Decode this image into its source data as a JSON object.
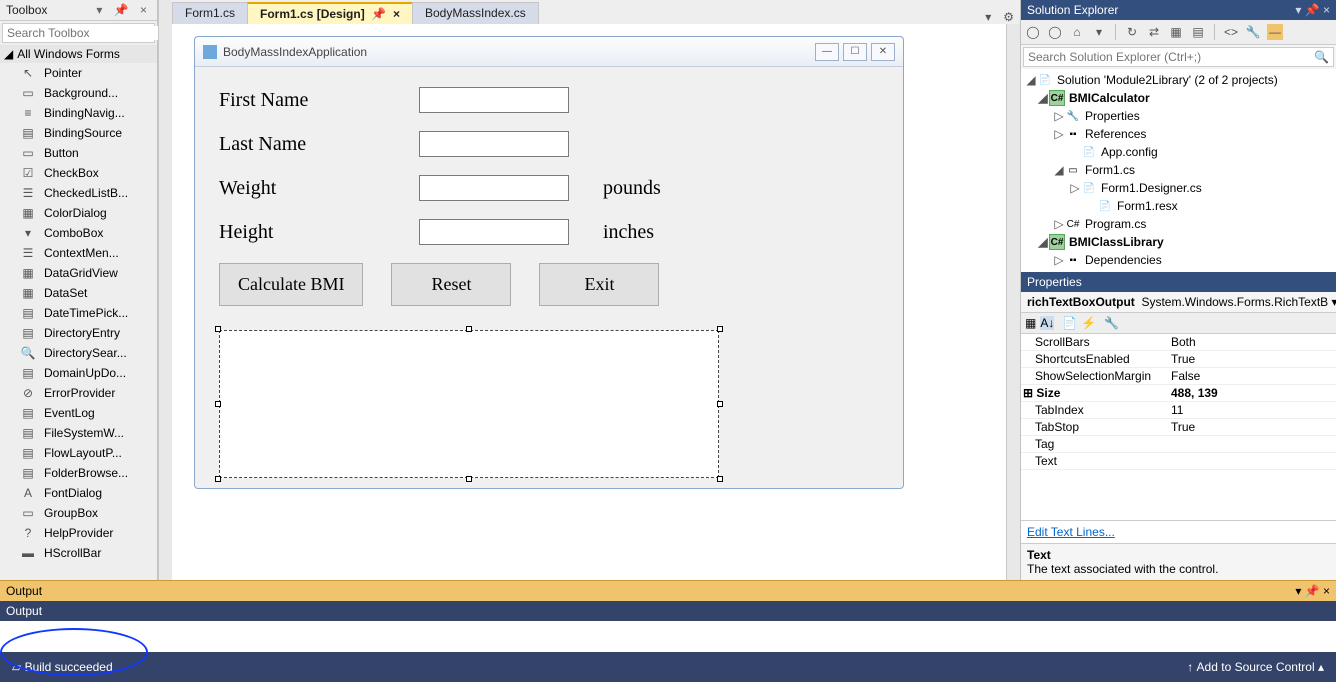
{
  "toolbox": {
    "title": "Toolbox",
    "search_placeholder": "Search Toolbox",
    "group": "All Windows Forms",
    "items": [
      {
        "icon": "↖",
        "label": "Pointer"
      },
      {
        "icon": "▭",
        "label": "Background..."
      },
      {
        "icon": "≡",
        "label": "BindingNavig..."
      },
      {
        "icon": "▤",
        "label": "BindingSource"
      },
      {
        "icon": "▭",
        "label": "Button"
      },
      {
        "icon": "☑",
        "label": "CheckBox"
      },
      {
        "icon": "☰",
        "label": "CheckedListB..."
      },
      {
        "icon": "▦",
        "label": "ColorDialog"
      },
      {
        "icon": "▾",
        "label": "ComboBox"
      },
      {
        "icon": "☰",
        "label": "ContextMen..."
      },
      {
        "icon": "▦",
        "label": "DataGridView"
      },
      {
        "icon": "▦",
        "label": "DataSet"
      },
      {
        "icon": "▤",
        "label": "DateTimePick..."
      },
      {
        "icon": "▤",
        "label": "DirectoryEntry"
      },
      {
        "icon": "🔍",
        "label": "DirectorySear..."
      },
      {
        "icon": "▤",
        "label": "DomainUpDo..."
      },
      {
        "icon": "⊘",
        "label": "ErrorProvider"
      },
      {
        "icon": "▤",
        "label": "EventLog"
      },
      {
        "icon": "▤",
        "label": "FileSystemW..."
      },
      {
        "icon": "▤",
        "label": "FlowLayoutP..."
      },
      {
        "icon": "▤",
        "label": "FolderBrowse..."
      },
      {
        "icon": "A",
        "label": "FontDialog"
      },
      {
        "icon": "▭",
        "label": "GroupBox"
      },
      {
        "icon": "?",
        "label": "HelpProvider"
      },
      {
        "icon": "▬",
        "label": "HScrollBar"
      }
    ]
  },
  "tabs": [
    {
      "label": "Form1.cs",
      "active": false,
      "bold": false
    },
    {
      "label": "Form1.cs [Design]",
      "active": true,
      "bold": true,
      "pin": "📌",
      "close": "×"
    },
    {
      "label": "BodyMassIndex.cs",
      "active": false,
      "bold": false
    }
  ],
  "form": {
    "title": "BodyMassIndexApplication",
    "labels": {
      "first": "First Name",
      "last": "Last Name",
      "weight": "Weight",
      "height": "Height"
    },
    "units": {
      "weight": "pounds",
      "height": "inches"
    },
    "buttons": {
      "calc": "Calculate BMI",
      "reset": "Reset",
      "exit": "Exit"
    }
  },
  "solution": {
    "title": "Solution Explorer",
    "search_placeholder": "Search Solution Explorer (Ctrl+;)",
    "root": "Solution 'Module2Library' (2 of 2 projects)",
    "proj1": "BMICalculator",
    "nodes": {
      "properties": "Properties",
      "references": "References",
      "appconfig": "App.config",
      "form1": "Form1.cs",
      "form1d": "Form1.Designer.cs",
      "form1r": "Form1.resx",
      "program": "Program.cs"
    },
    "proj2": "BMIClassLibrary",
    "deps": "Dependencies"
  },
  "properties": {
    "title": "Properties",
    "object": "richTextBoxOutput",
    "type": "System.Windows.Forms.RichTextB",
    "rows": [
      {
        "name": "ScrollBars",
        "value": "Both"
      },
      {
        "name": "ShortcutsEnabled",
        "value": "True"
      },
      {
        "name": "ShowSelectionMargin",
        "value": "False"
      },
      {
        "name": "Size",
        "value": "488, 139",
        "bold": true,
        "exp": true
      },
      {
        "name": "TabIndex",
        "value": "11"
      },
      {
        "name": "TabStop",
        "value": "True"
      },
      {
        "name": "Tag",
        "value": ""
      },
      {
        "name": "Text",
        "value": ""
      }
    ],
    "link": "Edit Text Lines...",
    "desc_title": "Text",
    "desc_text": "The text associated with the control."
  },
  "output": {
    "title": "Output"
  },
  "status": {
    "build": "Build succeeded",
    "source": "Add to Source Control"
  }
}
